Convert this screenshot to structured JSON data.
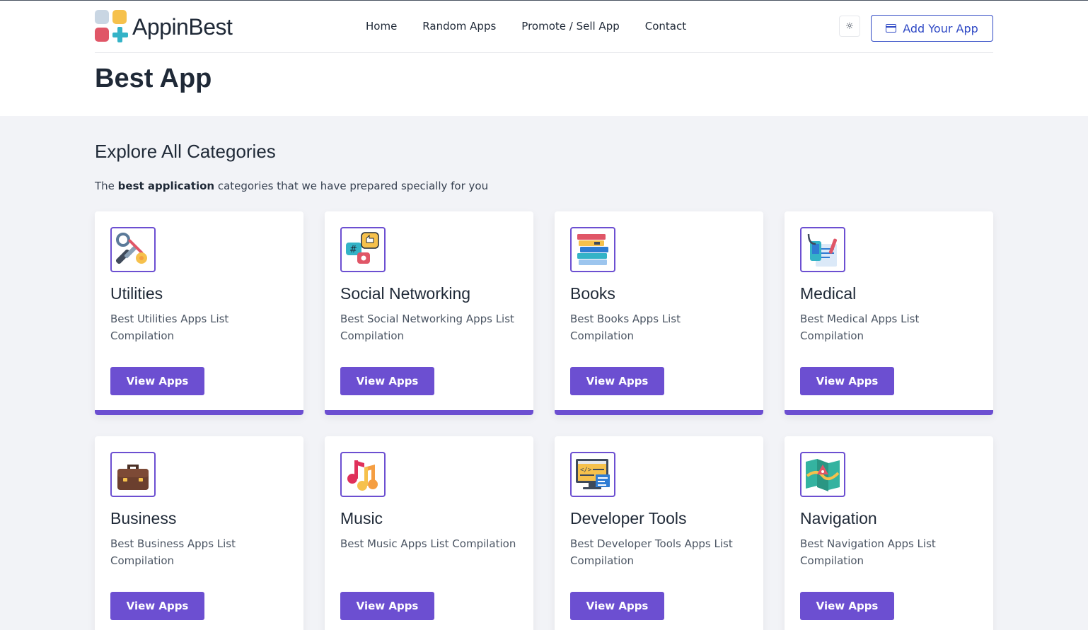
{
  "header": {
    "logo_text": "AppinBest",
    "nav": [
      "Home",
      "Random Apps",
      "Promote / Sell App",
      "Contact"
    ],
    "theme_toggle_icon": "sun-icon",
    "add_app_label": "Add Your App",
    "add_app_icon": "store-icon"
  },
  "page": {
    "title": "Best App"
  },
  "section": {
    "title": "Explore All Categories",
    "subtitle_pre": "The ",
    "subtitle_bold": "best application",
    "subtitle_post": " categories that we have prepared specially for you"
  },
  "colors": {
    "accent": "#6c4fd1",
    "brand_blue": "#2f49c5",
    "background": "#f2f3f7"
  },
  "categories": [
    {
      "name": "Utilities",
      "description": "Best Utilities Apps List Compilation",
      "button": "View Apps",
      "icon": "tools-icon"
    },
    {
      "name": "Social Networking",
      "description": "Best Social Networking Apps List Compilation",
      "button": "View Apps",
      "icon": "social-chat-icon"
    },
    {
      "name": "Books",
      "description": "Best Books Apps List Compilation",
      "button": "View Apps",
      "icon": "books-icon"
    },
    {
      "name": "Medical",
      "description": "Best Medical Apps List Compilation",
      "button": "View Apps",
      "icon": "medical-icon"
    },
    {
      "name": "Business",
      "description": "Best Business Apps List Compilation",
      "button": "View Apps",
      "icon": "briefcase-icon"
    },
    {
      "name": "Music",
      "description": "Best Music Apps List Compilation",
      "button": "View Apps",
      "icon": "music-note-icon"
    },
    {
      "name": "Developer Tools",
      "description": "Best Developer Tools Apps List Compilation",
      "button": "View Apps",
      "icon": "code-monitor-icon"
    },
    {
      "name": "Navigation",
      "description": "Best Navigation Apps List Compilation",
      "button": "View Apps",
      "icon": "map-icon"
    }
  ]
}
